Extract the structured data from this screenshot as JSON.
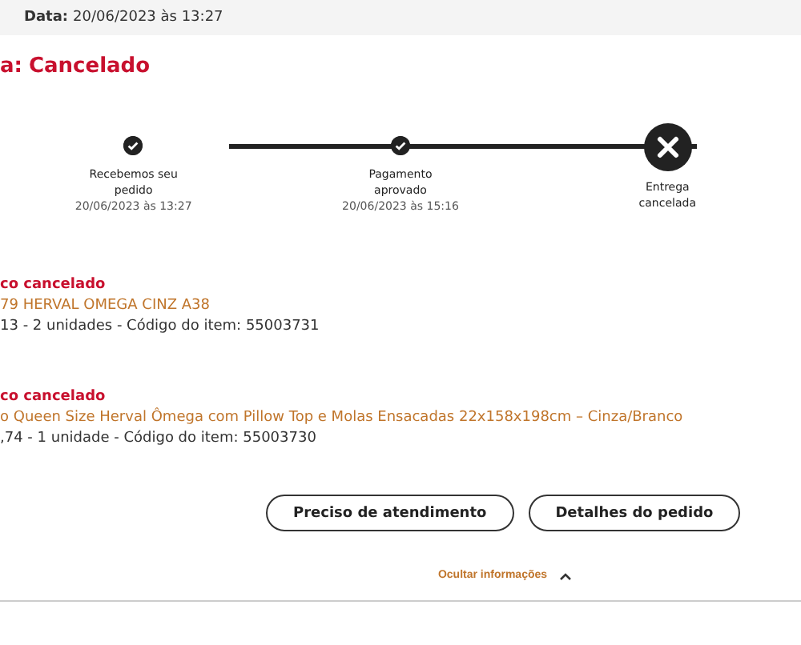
{
  "header": {
    "date_label": "Data:",
    "date_value": "20/06/2023 às 13:27"
  },
  "status": {
    "label": "a:",
    "value": "Cancelado"
  },
  "steps": [
    {
      "kind": "done",
      "label": "Recebemos seu pedido",
      "time": "20/06/2023 às 13:27"
    },
    {
      "kind": "done",
      "label": "Pagamento aprovado",
      "time": "20/06/2023 às 15:16"
    },
    {
      "kind": "cancelled",
      "label": "Entrega cancelada"
    }
  ],
  "items": [
    {
      "status": "co cancelado",
      "name": "79 HERVAL OMEGA CINZ A38",
      "details": "13 - 2 unidades - Código do item: 55003731"
    },
    {
      "status": "co cancelado",
      "name": "o Queen Size Herval Ômega com Pillow Top e Molas Ensacadas 22x158x198cm – Cinza/Branco",
      "details": ",74 - 1 unidade - Código do item: 55003730"
    }
  ],
  "buttons": [
    "Preciso de atendimento",
    "Detalhes do pedido"
  ],
  "toggle": {
    "label": "Ocultar informações",
    "expanded": true
  }
}
